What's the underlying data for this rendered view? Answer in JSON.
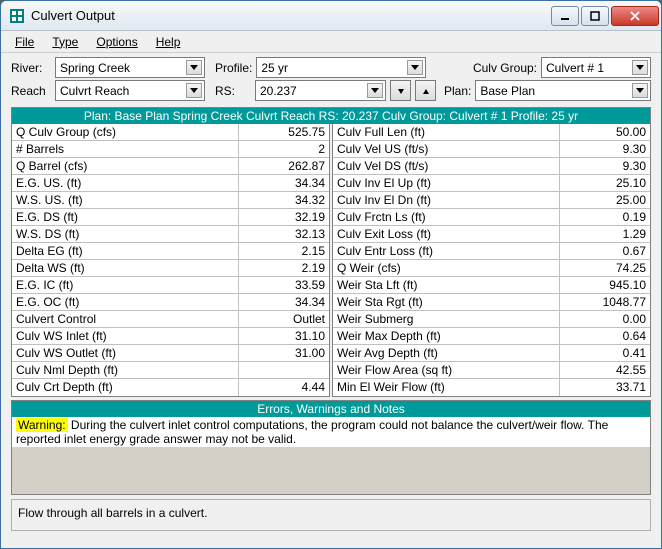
{
  "window": {
    "title": "Culvert Output"
  },
  "menu": {
    "file": "File",
    "type": "Type",
    "options": "Options",
    "help": "Help"
  },
  "row1": {
    "river_label": "River:",
    "river_value": "Spring Creek",
    "profile_label": "Profile:",
    "profile_value": "25 yr",
    "group_label": "Culv Group:",
    "group_value": "Culvert # 1"
  },
  "row2": {
    "reach_label": "Reach",
    "reach_value": "Culvrt Reach",
    "rs_label": "RS:",
    "rs_value": "20.237",
    "plan_label": "Plan:",
    "plan_value": "Base Plan"
  },
  "header_teal": "Plan: Base Plan    Spring Creek    Culvrt Reach  RS: 20.237   Culv Group:  Culvert # 1   Profile: 25 yr",
  "left": [
    {
      "l": "Q Culv Group (cfs)",
      "r": "525.75"
    },
    {
      "l": "# Barrels",
      "r": "2"
    },
    {
      "l": "Q Barrel (cfs)",
      "r": "262.87"
    },
    {
      "l": "E.G. US. (ft)",
      "r": "34.34"
    },
    {
      "l": "W.S. US. (ft)",
      "r": "34.32"
    },
    {
      "l": "E.G. DS (ft)",
      "r": "32.19"
    },
    {
      "l": "W.S. DS (ft)",
      "r": "32.13"
    },
    {
      "l": "Delta EG (ft)",
      "r": "2.15"
    },
    {
      "l": "Delta WS (ft)",
      "r": "2.19"
    },
    {
      "l": "E.G. IC (ft)",
      "r": "33.59"
    },
    {
      "l": "E.G. OC (ft)",
      "r": "34.34"
    },
    {
      "l": "Culvert Control",
      "r": "Outlet"
    },
    {
      "l": "Culv WS Inlet (ft)",
      "r": "31.10"
    },
    {
      "l": "Culv WS Outlet (ft)",
      "r": "31.00"
    },
    {
      "l": "Culv Nml Depth (ft)",
      "r": ""
    },
    {
      "l": "Culv Crt Depth (ft)",
      "r": "4.44"
    }
  ],
  "right": [
    {
      "l": "Culv Full Len (ft)",
      "r": "50.00"
    },
    {
      "l": "Culv Vel US (ft/s)",
      "r": "9.30"
    },
    {
      "l": "Culv Vel DS (ft/s)",
      "r": "9.30"
    },
    {
      "l": "Culv Inv El Up (ft)",
      "r": "25.10"
    },
    {
      "l": "Culv Inv El Dn (ft)",
      "r": "25.00"
    },
    {
      "l": "Culv Frctn Ls (ft)",
      "r": "0.19"
    },
    {
      "l": "Culv Exit Loss (ft)",
      "r": "1.29"
    },
    {
      "l": "Culv Entr Loss (ft)",
      "r": "0.67"
    },
    {
      "l": "Q Weir (cfs)",
      "r": "74.25"
    },
    {
      "l": "Weir Sta Lft (ft)",
      "r": "945.10"
    },
    {
      "l": "Weir Sta Rgt (ft)",
      "r": "1048.77"
    },
    {
      "l": "Weir Submerg",
      "r": "0.00"
    },
    {
      "l": "Weir Max Depth (ft)",
      "r": "0.64"
    },
    {
      "l": "Weir Avg Depth (ft)",
      "r": "0.41"
    },
    {
      "l": "Weir Flow Area (sq ft)",
      "r": "42.55"
    },
    {
      "l": "Min El Weir Flow (ft)",
      "r": "33.71"
    }
  ],
  "warnings_header": "Errors, Warnings and Notes",
  "warning": {
    "label": "Warning:",
    "text": "During the culvert inlet control computations, the program could not balance the culvert/weir flow.  The reported inlet energy grade answer may not be valid."
  },
  "status": "Flow through all barrels in a culvert."
}
